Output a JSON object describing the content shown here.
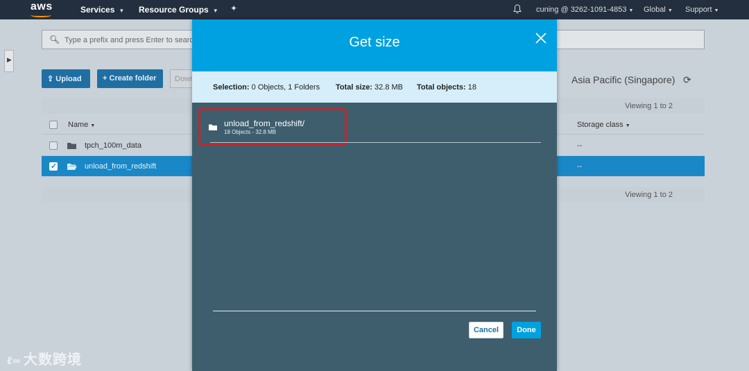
{
  "topnav": {
    "logo": "aws",
    "services": "Services",
    "resource_groups": "Resource Groups",
    "account": "cuning @ 3262-1091-4853",
    "region": "Global",
    "support": "Support"
  },
  "console": {
    "search_placeholder": "Type a prefix and press Enter to search",
    "upload_label": "Upload",
    "create_folder_label": "Create folder",
    "download_label": "Download",
    "region_label": "Asia Pacific (Singapore)",
    "viewing_top": "Viewing 1 to 2",
    "viewing_bottom": "Viewing 1 to 2",
    "columns": {
      "name": "Name",
      "storage_class": "Storage class"
    },
    "rows": [
      {
        "name": "tpch_100m_data",
        "storage_class": "--",
        "selected": false
      },
      {
        "name": "unload_from_redshift",
        "storage_class": "--",
        "selected": true
      }
    ]
  },
  "modal": {
    "title": "Get size",
    "selection_label": "Selection:",
    "selection_value": "0 Objects, 1 Folders",
    "total_size_label": "Total size:",
    "total_size_value": "32.8 MB",
    "total_objects_label": "Total objects:",
    "total_objects_value": "18",
    "item": {
      "name": "unload_from_redshift/",
      "detail": "18 Objects - 32.8 MB"
    },
    "cancel_label": "Cancel",
    "done_label": "Done"
  },
  "watermark": {
    "text": "大数跨境"
  },
  "colors": {
    "nav_bg": "#232f3e",
    "modal_header": "#00a1e0",
    "modal_body": "#3e5e6e",
    "summary_bg": "#d5eef9",
    "selected_row": "#1a87c6",
    "highlight_box": "#c1272d"
  }
}
